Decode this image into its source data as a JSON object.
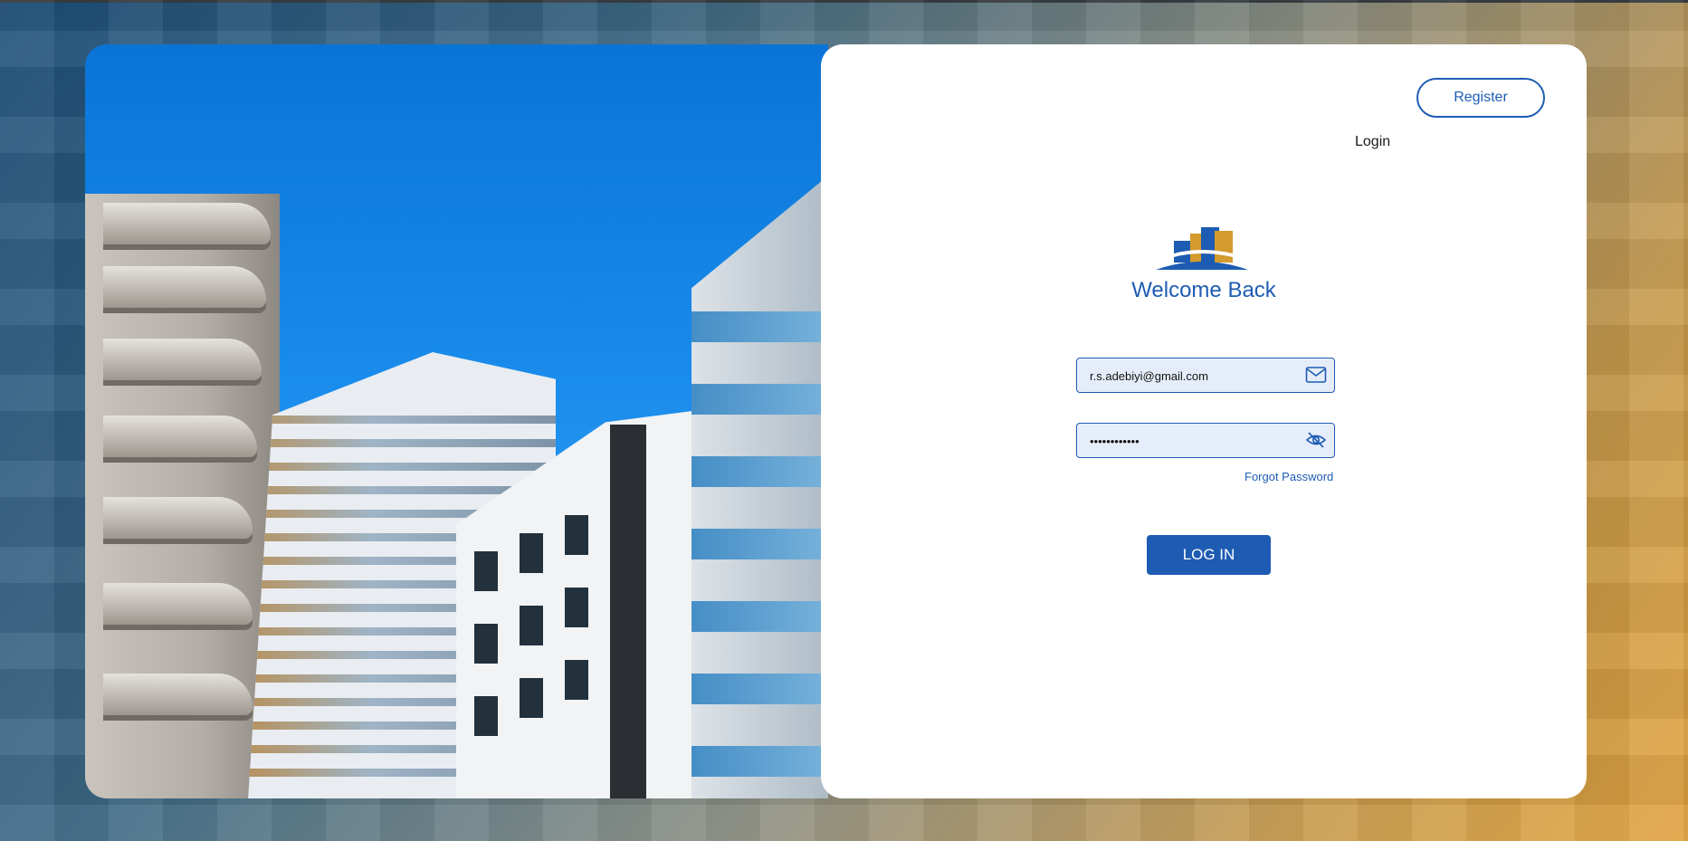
{
  "header": {
    "login_label": "Login",
    "register_label": "Register"
  },
  "form": {
    "title": "Welcome Back",
    "email_value": "r.s.adebiyi@gmail.com",
    "password_value": "••••••••••••",
    "forgot_password_label": "Forgot Password",
    "submit_label": "LOG IN"
  },
  "icons": {
    "email": "mail-icon",
    "password_toggle": "eye-off-icon",
    "logo": "buildings-logo"
  },
  "colors": {
    "accent": "#1e5cb3",
    "input_bg": "#e6edfa",
    "logo_gold": "#d39a2e"
  }
}
